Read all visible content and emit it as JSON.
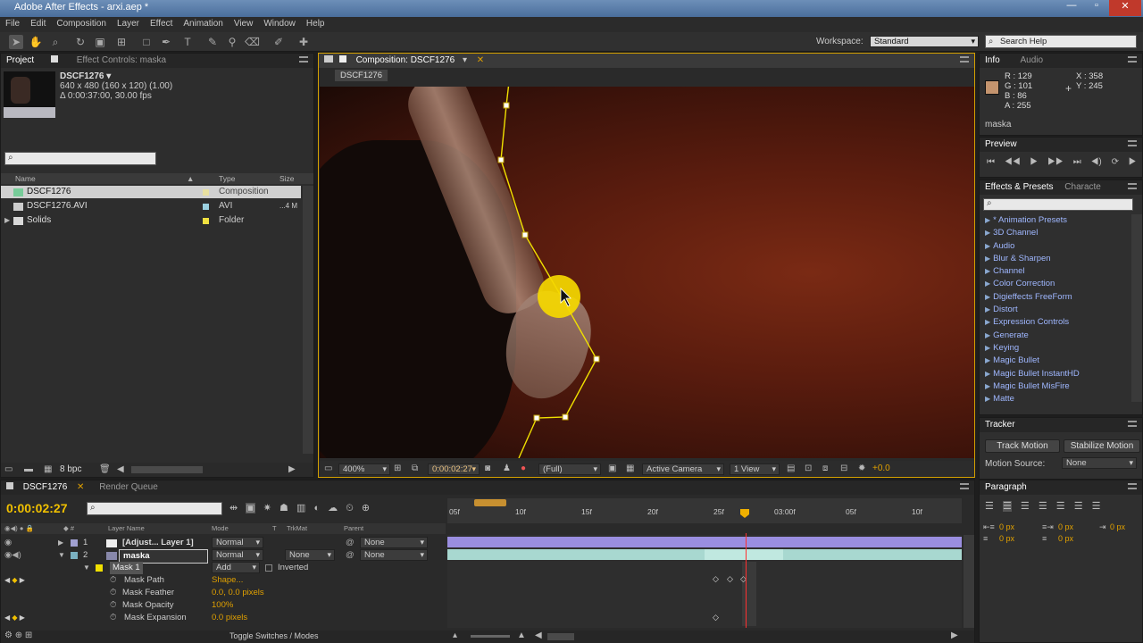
{
  "window": {
    "title": "Adobe After Effects - arxi.aep *"
  },
  "menu": [
    "File",
    "Edit",
    "Composition",
    "Layer",
    "Effect",
    "Animation",
    "View",
    "Window",
    "Help"
  ],
  "toolbar": {
    "workspace_label": "Workspace:",
    "workspace_value": "Standard",
    "search_placeholder": "Search Help"
  },
  "project": {
    "tab": "Project",
    "tab2": "Effect Controls: maska",
    "comp_name": "DSCF1276 ▾",
    "comp_info1": "640 x 480  (160 x 120) (1.00)",
    "comp_info2": "Δ 0:00:37:00, 30.00 fps",
    "col_name": "Name",
    "col_type": "Type",
    "col_size": "Size",
    "items": [
      {
        "name": "DSCF1276",
        "type": "Composition",
        "size": ""
      },
      {
        "name": "DSCF1276.AVI",
        "type": "AVI",
        "size": "...4 M"
      },
      {
        "name": "Solids",
        "type": "Folder",
        "size": ""
      }
    ],
    "bpc": "8 bpc"
  },
  "composition": {
    "tab": "Composition: DSCF1276",
    "subtab": "DSCF1276",
    "zoom": "400%",
    "timecode": "0:00:02:27",
    "resolution": "(Full)",
    "camera": "Active Camera",
    "view": "1 View",
    "exposure": "+0.0"
  },
  "info": {
    "tab": "Info",
    "tab2": "Audio",
    "r": "R : 129",
    "g": "G : 101",
    "b": "B : 86",
    "a": "A : 255",
    "x": "X : 358",
    "y": "Y : 245",
    "layer": "maska",
    "swatch_color": "#c4946e"
  },
  "preview": {
    "tab": "Preview"
  },
  "effects": {
    "tab": "Effects & Presets",
    "tab2": "Characte",
    "items": [
      "* Animation Presets",
      "3D Channel",
      "Audio",
      "Blur & Sharpen",
      "Channel",
      "Color Correction",
      "Digieffects FreeForm",
      "Distort",
      "Expression Controls",
      "Generate",
      "Keying",
      "Magic Bullet",
      "Magic Bullet InstantHD",
      "Magic Bullet MisFire",
      "Matte"
    ]
  },
  "tracker": {
    "tab": "Tracker",
    "track_motion": "Track Motion",
    "stabilize_motion": "Stabilize Motion",
    "motion_source_label": "Motion Source:",
    "motion_source_value": "None"
  },
  "paragraph": {
    "tab": "Paragraph",
    "v1": "0 px",
    "v2": "0 px",
    "v3": "0 px",
    "v4": "0 px",
    "v5": "0 px"
  },
  "timeline": {
    "tab": "DSCF1276",
    "tab2": "Render Queue",
    "timecode": "0:00:02:27",
    "col_layer": "Layer Name",
    "col_mode": "Mode",
    "col_t": "T",
    "col_trkmat": "TrkMat",
    "col_parent": "Parent",
    "ruler": [
      "05f",
      "10f",
      "15f",
      "20f",
      "25f",
      "03:00f",
      "05f",
      "10f"
    ],
    "layers": [
      {
        "num": "1",
        "name": "[Adjust... Layer 1]",
        "mode": "Normal",
        "trkmat": "",
        "parent": "None"
      },
      {
        "num": "2",
        "name": "maska",
        "mode": "Normal",
        "trkmat": "None",
        "parent": "None"
      }
    ],
    "mask": {
      "name": "Mask 1",
      "mode": "Add",
      "inverted": "Inverted"
    },
    "props": [
      {
        "name": "Mask Path",
        "value": "Shape..."
      },
      {
        "name": "Mask Feather",
        "value": "0.0, 0.0 pixels"
      },
      {
        "name": "Mask Opacity",
        "value": "100%"
      },
      {
        "name": "Mask Expansion",
        "value": "0.0 pixels"
      }
    ],
    "toggle": "Toggle Switches / Modes"
  }
}
